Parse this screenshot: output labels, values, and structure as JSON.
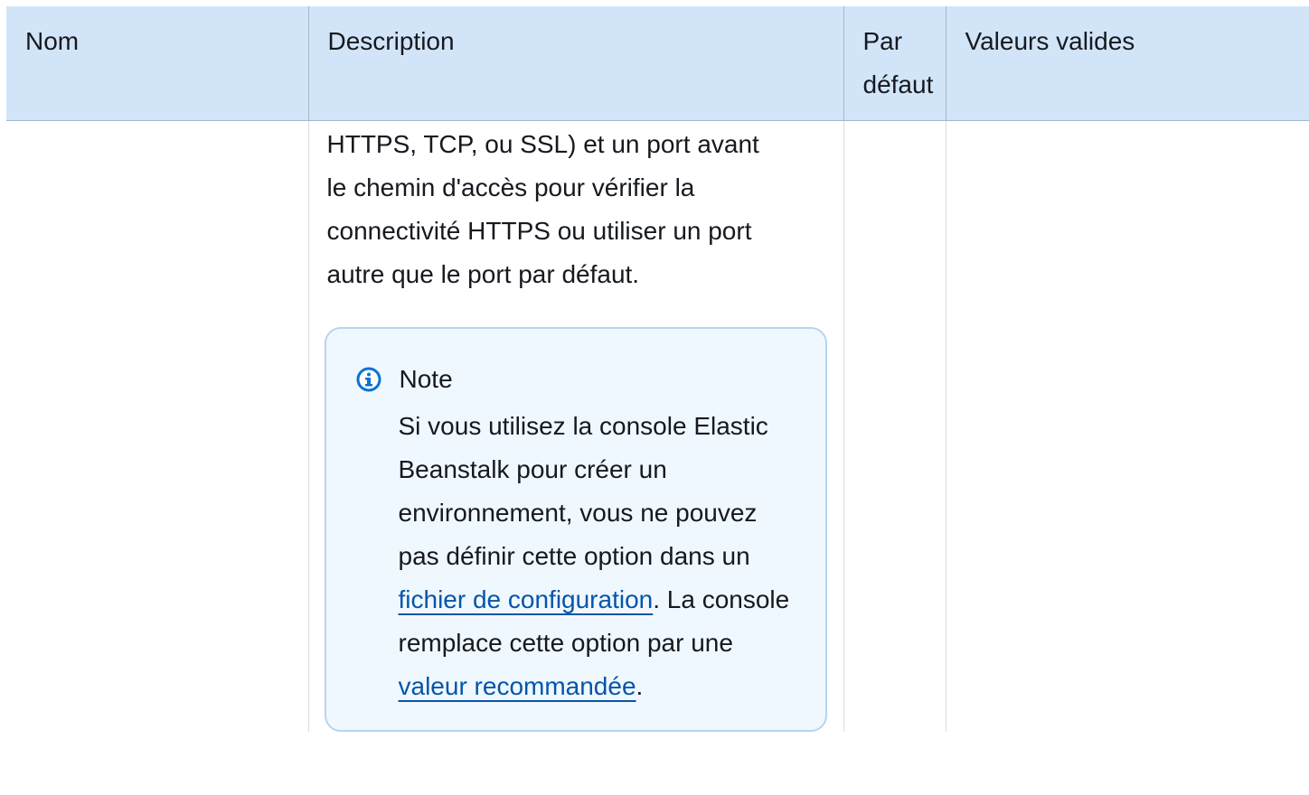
{
  "table": {
    "headers": {
      "name": "Nom",
      "description": "Description",
      "default": "Par défaut",
      "valid_values": "Valeurs valides"
    },
    "row": {
      "description_lines": [
        "HTTPS, TCP, ou SSL) et un port avant",
        "le chemin d'accès pour vérifier la",
        "connectivité HTTPS ou utiliser un port",
        "autre que le port par défaut."
      ],
      "note": {
        "icon": "info-icon",
        "title": "Note",
        "text_1": "Si vous utilisez la console Elastic Beanstalk pour créer un environnement, vous ne pouvez pas définir cette option dans un ",
        "link_1": "fichier de configuration",
        "text_2": ". La console remplace cette option par une ",
        "link_2": "valeur recommandée",
        "text_3": "."
      }
    }
  },
  "colors": {
    "header_bg": "#d2e5f8",
    "note_bg": "#f0f8ff",
    "note_border": "#b7d4f1",
    "link": "#0555a8"
  }
}
